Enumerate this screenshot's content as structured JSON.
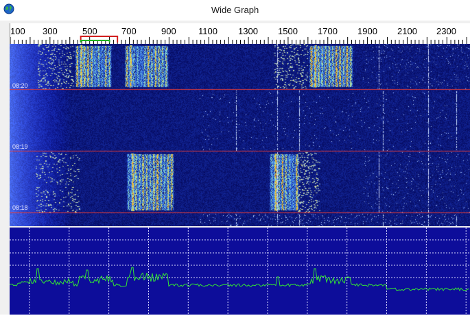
{
  "window": {
    "title": "Wide Graph",
    "icon": "globe-icon"
  },
  "frequency_scale": {
    "labels": [
      "100",
      "300",
      "500",
      "700",
      "900",
      "1100",
      "1300",
      "1500",
      "1700",
      "1900",
      "2100",
      "2300"
    ]
  },
  "waterfall": {
    "time_labels": [
      "08:20",
      "08:19",
      "08:18"
    ]
  },
  "colors": {
    "waterfall_background": "#0a1a6e",
    "separator_line": "#e03a3a",
    "spectrum_background": "#0d0d9a",
    "spectrum_grid": "#d9d9ff",
    "spectrum_trace": "#33e633",
    "rx_marker": "#d21e1e",
    "tx_marker": "#22b422"
  }
}
